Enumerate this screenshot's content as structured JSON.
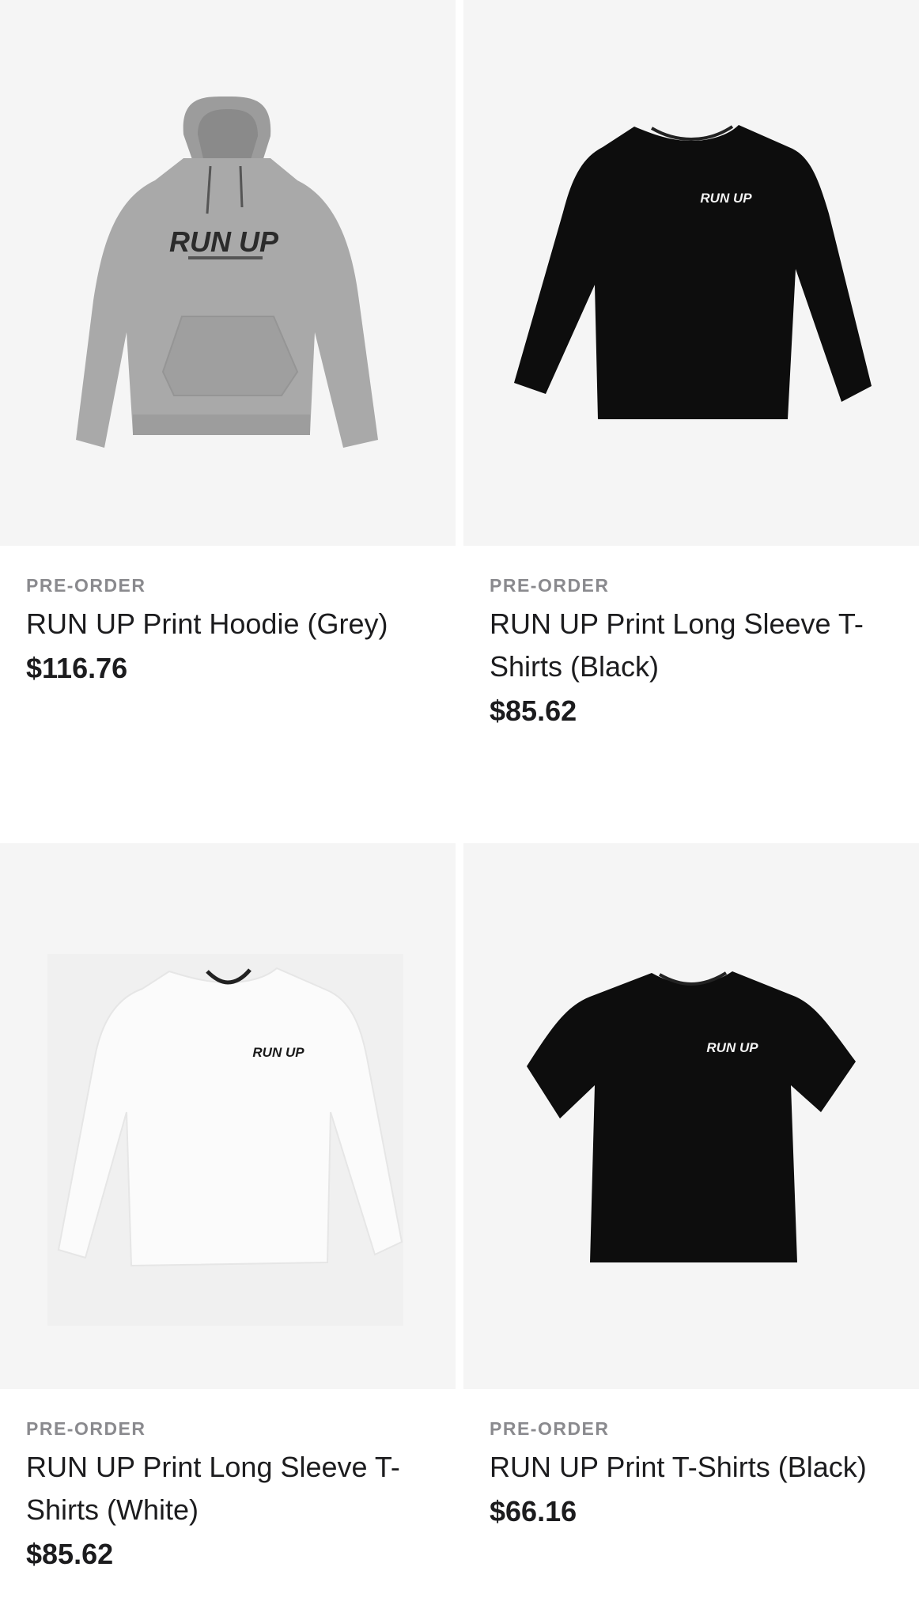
{
  "products": [
    {
      "badge": "PRE-ORDER",
      "title": "RUN UP Print Hoodie (Grey)",
      "price": "$116.76",
      "image_icon": "grey-hoodie",
      "print_text": "RUN UP",
      "garment_color": "#a9a9a9"
    },
    {
      "badge": "PRE-ORDER",
      "title": "RUN UP Print Long Sleeve T-Shirts (Black)",
      "price": "$85.62",
      "image_icon": "black-long-sleeve-tshirt",
      "print_text": "RUN UP",
      "garment_color": "#0d0d0d"
    },
    {
      "badge": "PRE-ORDER",
      "title": "RUN UP Print Long Sleeve T-Shirts (White)",
      "price": "$85.62",
      "image_icon": "white-long-sleeve-tshirt",
      "print_text": "RUN UP",
      "garment_color": "#fbfbfb"
    },
    {
      "badge": "PRE-ORDER",
      "title": "RUN UP Print T-Shirts (Black)",
      "price": "$66.16",
      "image_icon": "black-tshirt",
      "print_text": "RUN UP",
      "garment_color": "#0d0d0d"
    }
  ],
  "colors": {
    "image_background": "#f5f5f5",
    "badge_text": "#8a8a8e",
    "primary_text": "#1c1c1e"
  }
}
